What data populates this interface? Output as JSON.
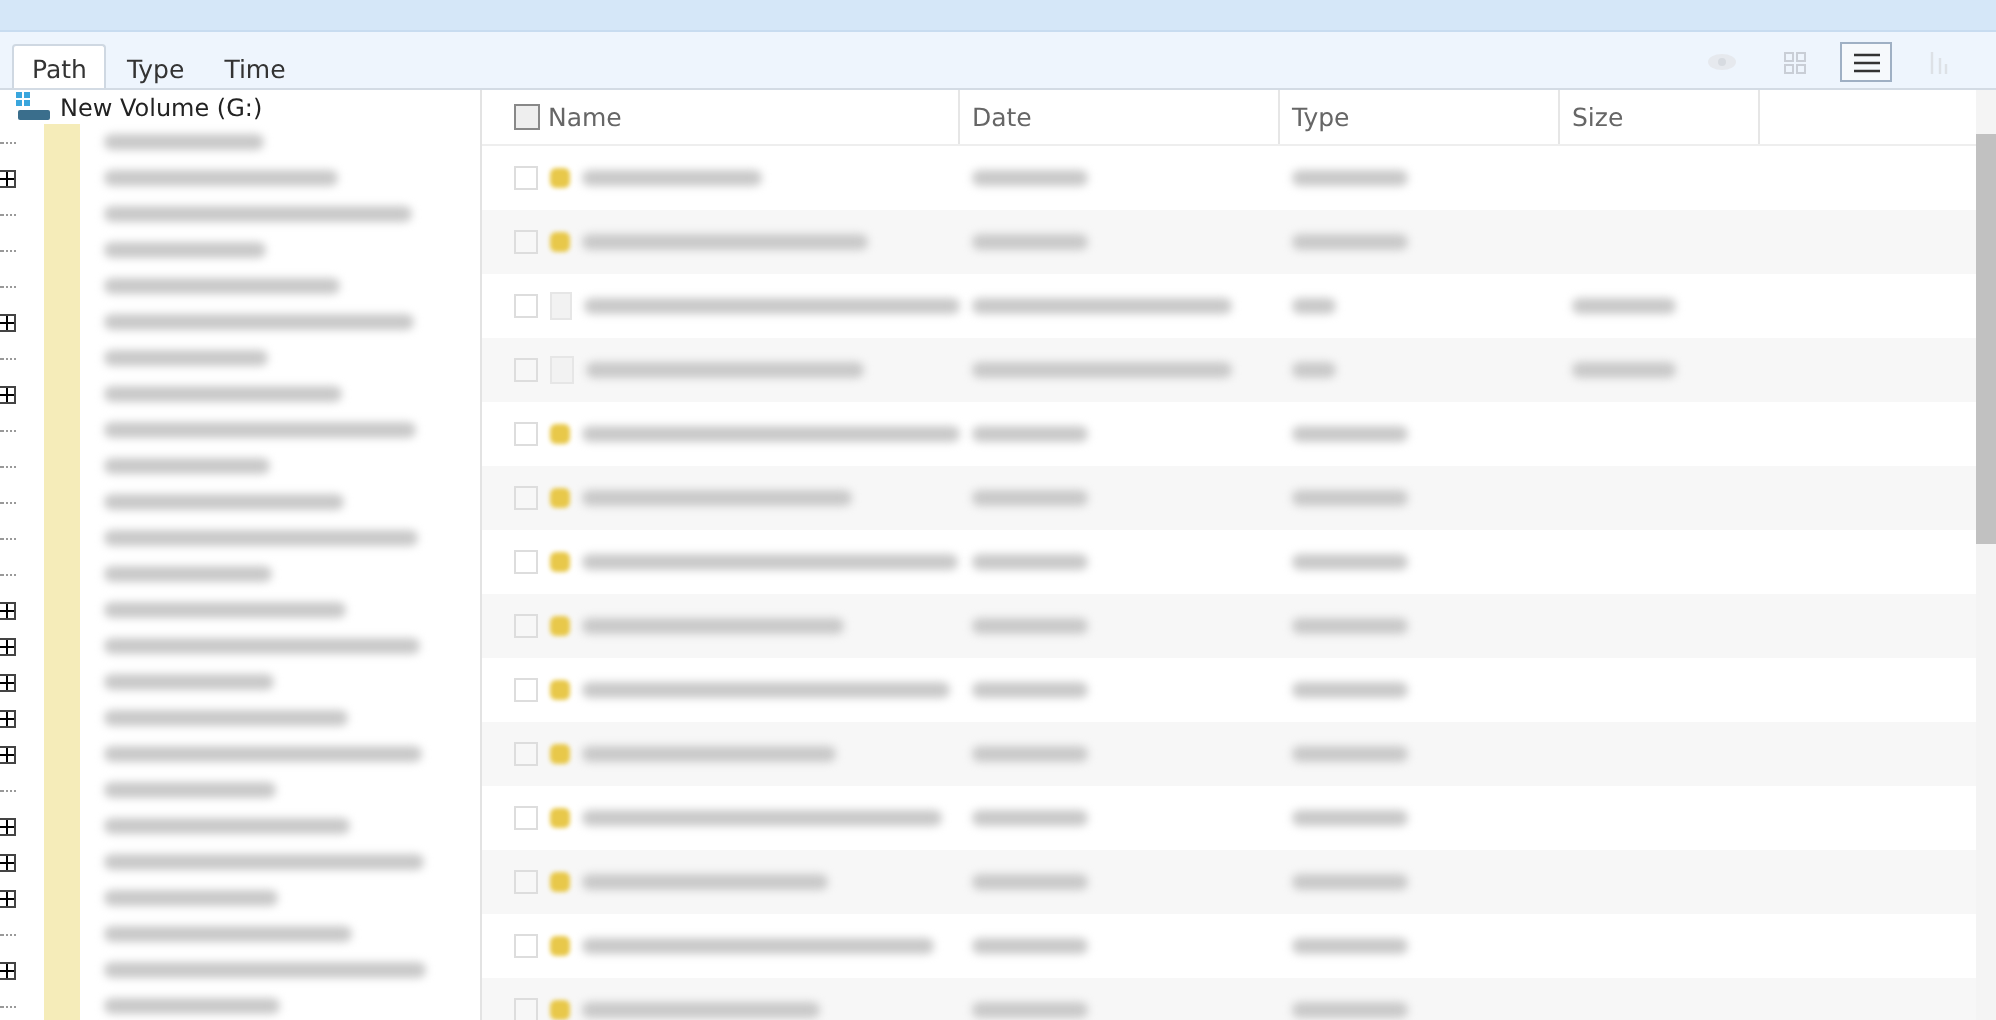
{
  "tabs": [
    {
      "label": "Path",
      "selected": true
    },
    {
      "label": "Type",
      "selected": false
    },
    {
      "label": "Time",
      "selected": false
    }
  ],
  "view_buttons": [
    {
      "kind": "eye",
      "selected": false
    },
    {
      "kind": "grid",
      "selected": false
    },
    {
      "kind": "list",
      "selected": true
    },
    {
      "kind": "columns",
      "selected": false
    }
  ],
  "tree": {
    "root": "New Volume (G:)",
    "items": [
      {
        "expandable": false
      },
      {
        "expandable": true
      },
      {
        "expandable": false
      },
      {
        "expandable": false
      },
      {
        "expandable": false
      },
      {
        "expandable": true
      },
      {
        "expandable": false
      },
      {
        "expandable": true
      },
      {
        "expandable": false
      },
      {
        "expandable": false
      },
      {
        "expandable": false
      },
      {
        "expandable": false
      },
      {
        "expandable": false
      },
      {
        "expandable": true
      },
      {
        "expandable": true
      },
      {
        "expandable": true
      },
      {
        "expandable": true
      },
      {
        "expandable": true
      },
      {
        "expandable": false
      },
      {
        "expandable": true
      },
      {
        "expandable": true
      },
      {
        "expandable": true
      },
      {
        "expandable": false
      },
      {
        "expandable": true
      },
      {
        "expandable": false
      }
    ]
  },
  "select_all": {
    "checked": false
  },
  "columns": [
    "Name",
    "Date",
    "Type",
    "Size"
  ],
  "rows": [
    {
      "kind": "folder",
      "checked": false
    },
    {
      "kind": "folder",
      "checked": false
    },
    {
      "kind": "file",
      "checked": false
    },
    {
      "kind": "file",
      "checked": false
    },
    {
      "kind": "folder",
      "checked": false
    },
    {
      "kind": "folder",
      "checked": false
    },
    {
      "kind": "folder",
      "checked": false
    },
    {
      "kind": "folder",
      "checked": false
    },
    {
      "kind": "folder",
      "checked": false
    },
    {
      "kind": "folder",
      "checked": false
    },
    {
      "kind": "folder",
      "checked": false
    },
    {
      "kind": "folder",
      "checked": false
    },
    {
      "kind": "folder",
      "checked": false
    },
    {
      "kind": "folder",
      "checked": false
    }
  ]
}
